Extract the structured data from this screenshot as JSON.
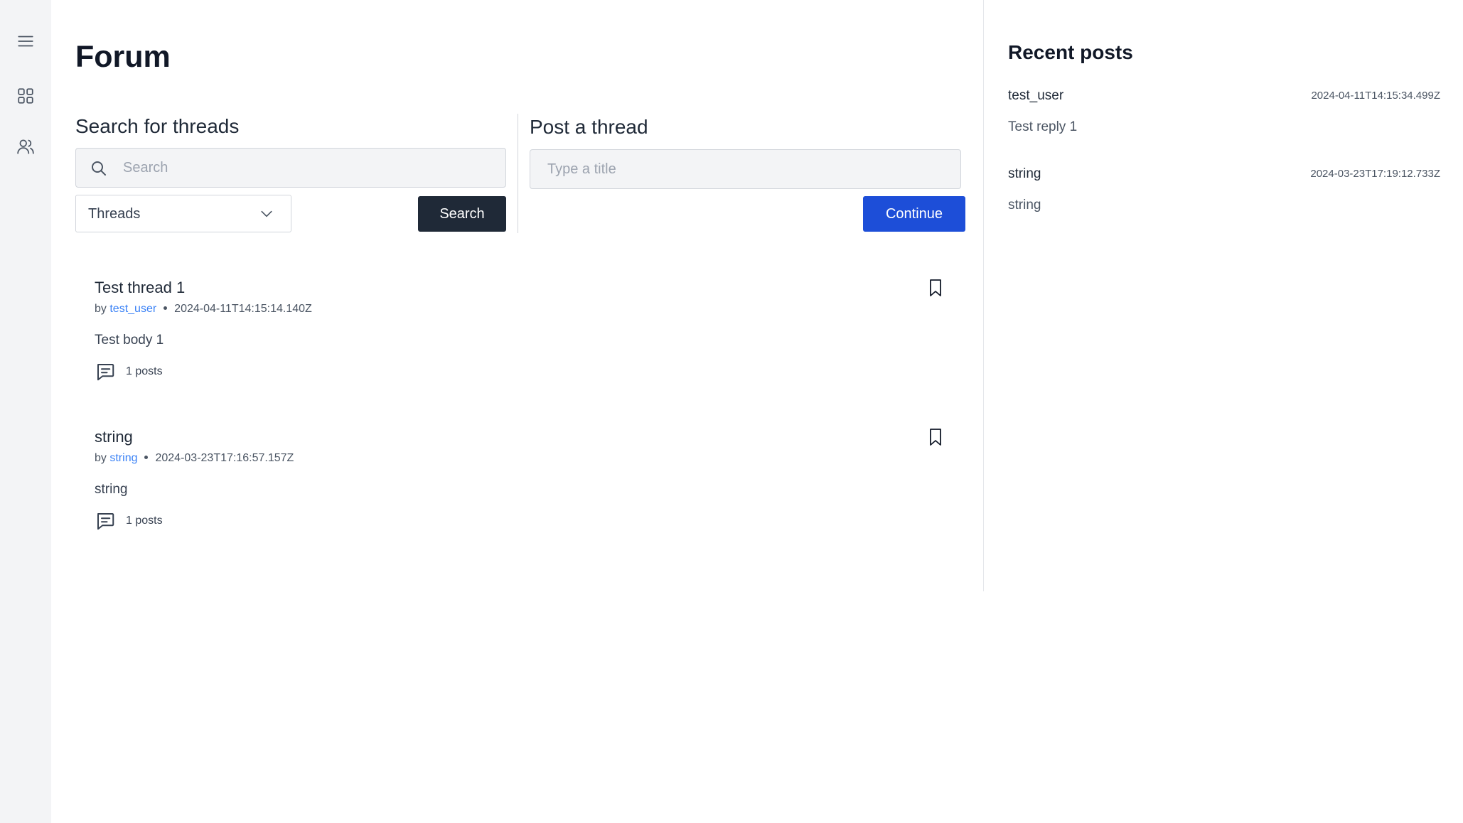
{
  "page": {
    "title": "Forum"
  },
  "search": {
    "heading": "Search for threads",
    "placeholder": "Search",
    "filter_value": "Threads",
    "button_label": "Search"
  },
  "post_thread": {
    "heading": "Post a thread",
    "placeholder": "Type a title",
    "button_label": "Continue"
  },
  "threads": [
    {
      "title": "Test thread 1",
      "by_label": "by",
      "author": "test_user",
      "timestamp": "2024-04-11T14:15:14.140Z",
      "body": "Test body 1",
      "posts_label": "1 posts"
    },
    {
      "title": "string",
      "by_label": "by",
      "author": "string",
      "timestamp": "2024-03-23T17:16:57.157Z",
      "body": "string",
      "posts_label": "1 posts"
    }
  ],
  "recent_posts": {
    "heading": "Recent posts",
    "items": [
      {
        "user": "test_user",
        "timestamp": "2024-04-11T14:15:34.499Z",
        "body": "Test reply 1"
      },
      {
        "user": "string",
        "timestamp": "2024-03-23T17:19:12.733Z",
        "body": "string"
      }
    ]
  },
  "sidebar": {
    "icons": [
      "menu-icon",
      "dashboard-icon",
      "users-icon"
    ]
  },
  "colors": {
    "primary_button": "#1d4ed8",
    "dark_button": "#1f2937",
    "author_link": "#3b82f6",
    "rail_background": "#f3f4f6"
  }
}
